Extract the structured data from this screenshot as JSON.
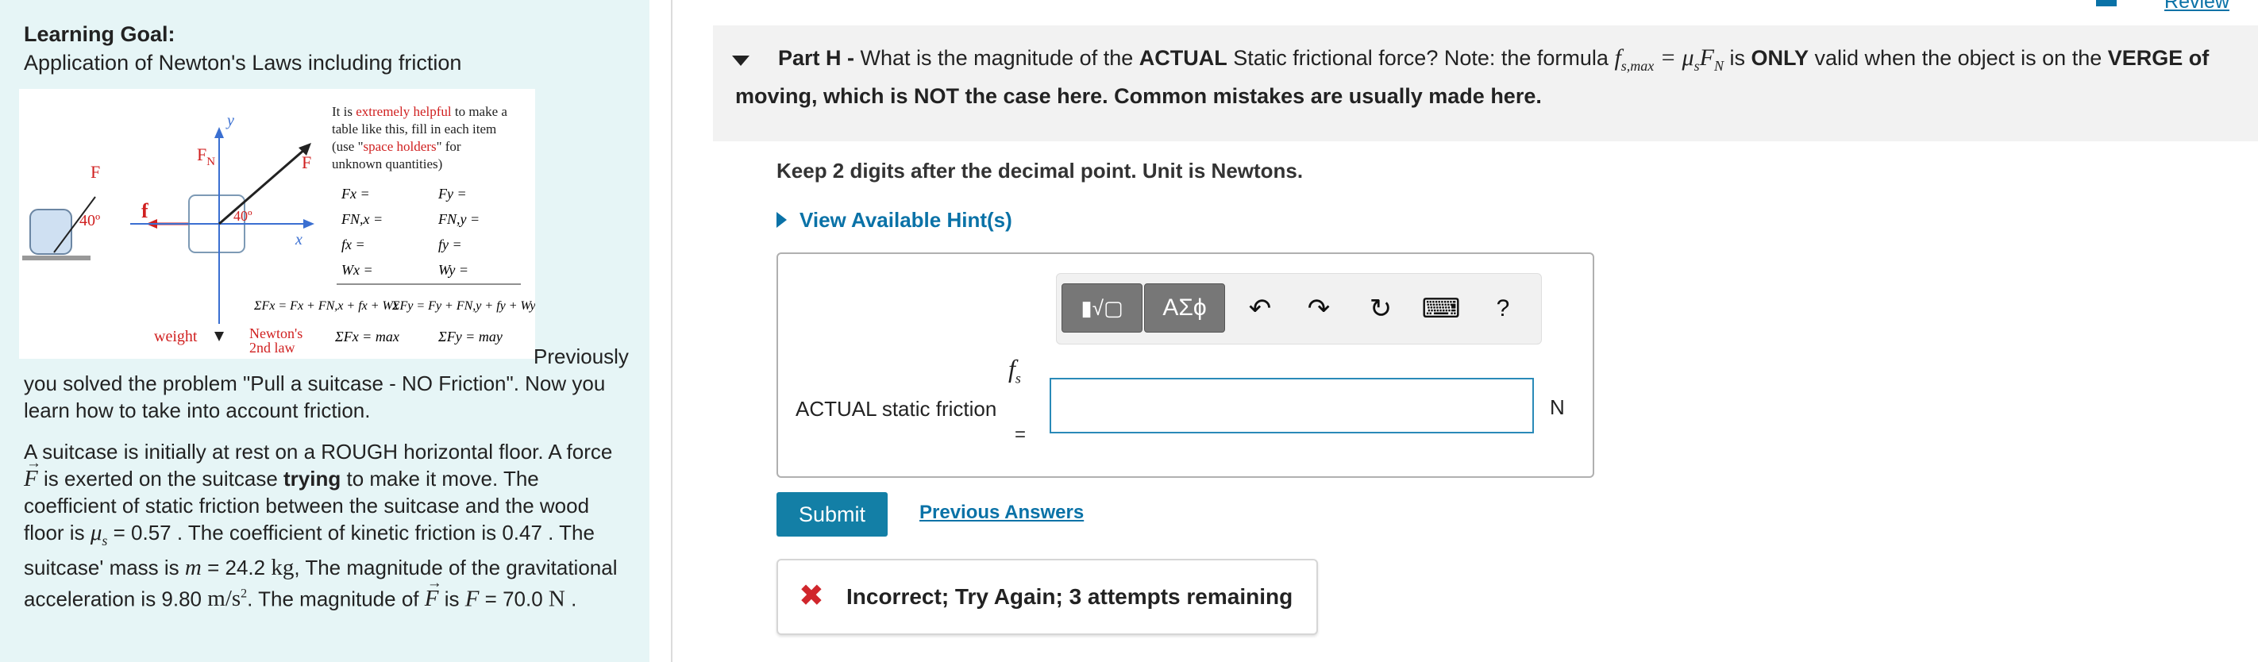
{
  "left": {
    "goal_heading": "Learning Goal:",
    "goal_text": "Application of Newton's Laws including friction",
    "figure": {
      "tip_prefix": "It is ",
      "tip_highlight": "extremely helpful",
      "tip_rest1": " to make a",
      "tip_line2": "table like this, fill in each item",
      "tip_line3_pre": "(use \"",
      "tip_line3_highlight": "space holders",
      "tip_line3_post": "\" for",
      "tip_line4": "unknown quantities)",
      "label_F_left": "F",
      "label_angle_left": "40º",
      "label_f": "f",
      "label_FN": "F",
      "label_FN_sub": "N",
      "label_y": "y",
      "label_x": "x",
      "label_F_right": "F",
      "label_angle_right": "40º",
      "label_weight": "weight",
      "table": [
        [
          "Fx =",
          "Fy ="
        ],
        [
          "FN,x =",
          "FN,y ="
        ],
        [
          "fx =",
          "fy ="
        ],
        [
          "Wx =",
          "Wy ="
        ]
      ],
      "sum_x": "ΣFx = Fx + FN,x + fx + Wx",
      "sum_y": "ΣFy = Fy + FN,y + fy + Wy",
      "newton_line1": "Newton's",
      "newton_line2": "2nd law",
      "newton_x": "ΣFx = max",
      "newton_y": "ΣFy = may"
    },
    "intro_tail": "Previously",
    "intro_rest": "you solved the problem \"Pull a suitcase - NO Friction\". Now you learn how to take into account friction.",
    "p1_a": "A suitcase is initially at rest on a ROUGH horizontal floor. A force",
    "p1_b": " is exerted on the suitcase ",
    "p1_bold": "trying",
    "p1_c": " to make it move. The coefficient of static friction between the suitcase and the wood floor is ",
    "mu_s_value": "= 0.57",
    "p1_d": ". The coefficient of kinetic friction is 0.47 . The suitcase' mass is ",
    "mass_value": "= 24.2",
    "mass_unit": "kg",
    "p1_e": ", The magnitude of the gravitational acceleration is 9.80",
    "g_unit": "m/s",
    "p1_f": ". The magnitude of",
    "p1_g": "is",
    "force_value": "= 70.0",
    "force_unit": "N",
    "p1_end": "."
  },
  "right": {
    "review_label": "Review",
    "part_label": "Part H -",
    "part_q1": " What is the magnitude of the ",
    "part_bold1": "ACTUAL",
    "part_q2": " Static frictional force? Note: the formula ",
    "formula": "fs,max = μsFN",
    "part_q3": " is ",
    "part_bold2": "ONLY",
    "part_q4": " valid when the object is on the ",
    "part_bold3": "VERGE of moving, which is NOT the case here. Common mistakes are usually made here.",
    "instructions": "Keep 2 digits after the decimal point. Unit is Newtons.",
    "hint_label": "View Available Hint(s)",
    "toolbar": {
      "templates_icon": "▮√▢",
      "symbols_label": "ΑΣϕ",
      "undo_icon": "↶",
      "redo_icon": "↷",
      "reset_icon": "↻",
      "keyboard_icon": "⌨",
      "help_label": "?"
    },
    "answer_label": "ACTUAL static friction",
    "answer_symbol": "fs",
    "answer_equals": "=",
    "answer_value": "",
    "unit": "N",
    "submit_label": "Submit",
    "previous_answers_label": "Previous Answers",
    "feedback_icon": "✖",
    "feedback_text": "Incorrect; Try Again; 3 attempts remaining",
    "colors": {
      "accent": "#137fa6",
      "link": "#0a72a7",
      "error": "#d0262c",
      "panel": "#e6f5f6"
    }
  }
}
